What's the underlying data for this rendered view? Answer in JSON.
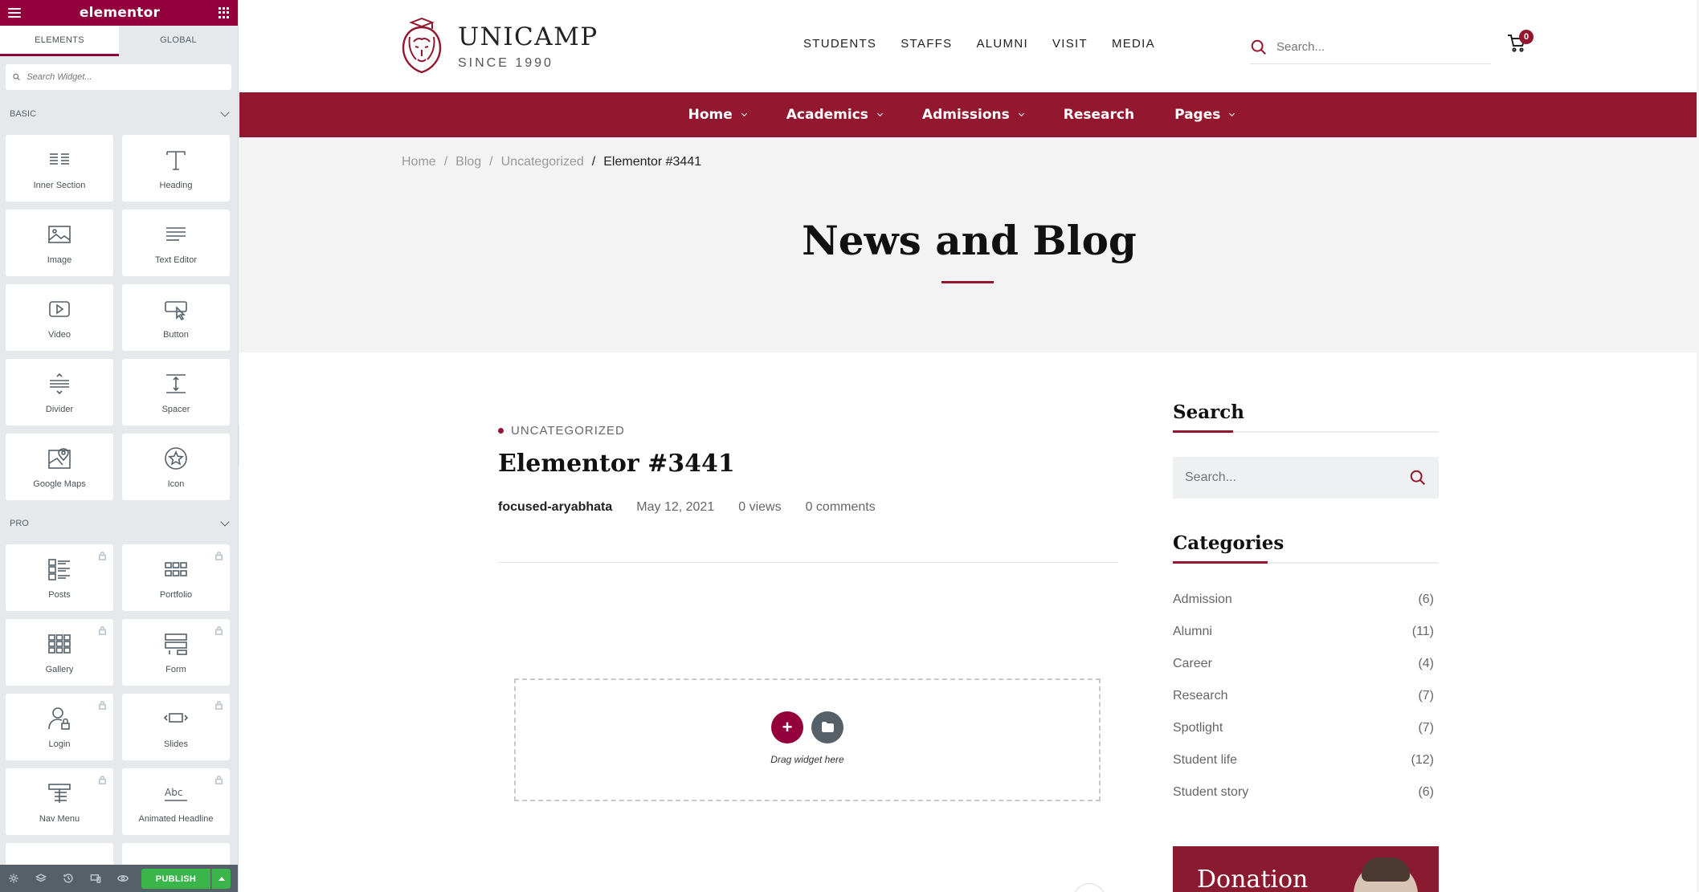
{
  "panel": {
    "logo": "elementor",
    "tabs": [
      "ELEMENTS",
      "GLOBAL"
    ],
    "search_placeholder": "Search Widget...",
    "categories": {
      "basic": {
        "label": "BASIC",
        "widgets": [
          {
            "label": "Inner Section",
            "icon": "inner-section-icon"
          },
          {
            "label": "Heading",
            "icon": "heading-icon"
          },
          {
            "label": "Image",
            "icon": "image-icon"
          },
          {
            "label": "Text Editor",
            "icon": "text-editor-icon"
          },
          {
            "label": "Video",
            "icon": "video-icon"
          },
          {
            "label": "Button",
            "icon": "button-icon"
          },
          {
            "label": "Divider",
            "icon": "divider-icon"
          },
          {
            "label": "Spacer",
            "icon": "spacer-icon"
          },
          {
            "label": "Google Maps",
            "icon": "google-maps-icon"
          },
          {
            "label": "Icon",
            "icon": "star-icon"
          }
        ]
      },
      "pro": {
        "label": "PRO",
        "widgets": [
          {
            "label": "Posts",
            "icon": "posts-icon"
          },
          {
            "label": "Portfolio",
            "icon": "portfolio-icon"
          },
          {
            "label": "Gallery",
            "icon": "gallery-icon"
          },
          {
            "label": "Form",
            "icon": "form-icon"
          },
          {
            "label": "Login",
            "icon": "login-icon"
          },
          {
            "label": "Slides",
            "icon": "slides-icon"
          },
          {
            "label": "Nav Menu",
            "icon": "nav-menu-icon"
          },
          {
            "label": "Animated Headline",
            "icon": "animated-headline-icon"
          }
        ]
      }
    },
    "footer": {
      "publish_label": "PUBLISH"
    },
    "accent_color": "#93003c",
    "publish_color": "#39b54a"
  },
  "site": {
    "brand": {
      "name": "UNICAMP",
      "since": "SINCE 1990"
    },
    "top_nav": [
      "STUDENTS",
      "STAFFS",
      "ALUMNI",
      "VISIT",
      "MEDIA"
    ],
    "search_placeholder": "Search...",
    "cart_count": "0",
    "main_nav": [
      {
        "label": "Home",
        "dropdown": true
      },
      {
        "label": "Academics",
        "dropdown": true
      },
      {
        "label": "Admissions",
        "dropdown": true
      },
      {
        "label": "Research",
        "dropdown": false
      },
      {
        "label": "Pages",
        "dropdown": true
      }
    ],
    "breadcrumb": [
      "Home",
      "Blog",
      "Uncategorized",
      "Elementor #3441"
    ],
    "breadcrumb_sep": "/",
    "page_title": "News and Blog",
    "brand_color": "#93182f"
  },
  "post": {
    "category": "UNCATEGORIZED",
    "title": "Elementor #3441",
    "author": "focused-aryabhata",
    "date": "May 12, 2021",
    "views": "0 views",
    "comments": "0 comments",
    "dropzone_text": "Drag widget here",
    "dropzone_add": "+"
  },
  "sidebar": {
    "search_title": "Search",
    "search_placeholder": "Search...",
    "categories_title": "Categories",
    "categories": [
      {
        "name": "Admission",
        "count": "(6)"
      },
      {
        "name": "Alumni",
        "count": "(11)"
      },
      {
        "name": "Career",
        "count": "(4)"
      },
      {
        "name": "Research",
        "count": "(7)"
      },
      {
        "name": "Spotlight",
        "count": "(7)"
      },
      {
        "name": "Student life",
        "count": "(12)"
      },
      {
        "name": "Student story",
        "count": "(6)"
      }
    ],
    "donation_title": "Donation"
  }
}
